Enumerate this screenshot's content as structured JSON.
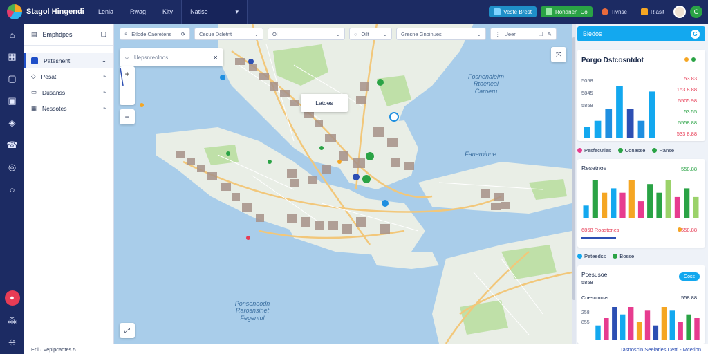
{
  "app": {
    "title": "Stagol Hingendi"
  },
  "topnav": [
    {
      "label": "Lenia"
    },
    {
      "label": "Rwag"
    },
    {
      "label": "Kity"
    },
    {
      "label": "Natise",
      "active": true
    }
  ],
  "topright": {
    "pill_blue": "Veste Brest",
    "pill_green": "Ronanen",
    "pill_green_badge": "Co",
    "item_1": "Tivnse",
    "item_2": "Riasit",
    "round_btn": "G"
  },
  "rail_icons": [
    "home-icon",
    "grid-icon",
    "square-icon",
    "folder-icon",
    "layers-icon",
    "phone-icon",
    "compass-icon",
    "search-icon"
  ],
  "rail_bottom_icons": [
    "alert-icon",
    "apps-icon",
    "settings-icon"
  ],
  "layers": {
    "title": "Emphdpes",
    "items": [
      {
        "label": "Patesnent",
        "selected": true
      },
      {
        "label": "Pesat"
      },
      {
        "label": "Dusanss"
      },
      {
        "label": "Nessotes"
      }
    ]
  },
  "filters": [
    {
      "label": "Etlode Caeretens"
    },
    {
      "label": "Cesue Dcletnt"
    },
    {
      "label": "Ol"
    },
    {
      "label": "Oilt"
    },
    {
      "label": "Gresne Gnoinues"
    },
    {
      "label": "Ueer"
    }
  ],
  "search": {
    "placeholder": "Uepsnreolnos"
  },
  "map": {
    "popup": "Latoes",
    "water_labels": [
      {
        "text": "Fosnenaleirn\nRtoeneal\nCaroeru"
      },
      {
        "text": "Faneroinne"
      },
      {
        "text": "Ponseneodn\nRarosnsinet\nFegentul"
      }
    ],
    "colors": {
      "water": "#a9cdea",
      "land": "#e9eee6",
      "park": "#bfe0a8",
      "road": "#f2c77a",
      "block": "#a79289"
    }
  },
  "right": {
    "header": "Bledos",
    "header_btn": "G",
    "card1": {
      "title": "Porgo Dstcosntdot",
      "values": [
        "53.83",
        "153 8.88",
        "5505.98",
        "53.55",
        "5558.88",
        "533 8.88"
      ],
      "value_colors": [
        "#e73c55",
        "#e73c55",
        "#e73c55",
        "#2aa345",
        "#2aa345",
        "#e73c55"
      ],
      "labels": [
        "5058",
        "5845",
        "5858"
      ]
    },
    "legend1": [
      {
        "label": "Pesfecuties",
        "color": "#e73c8f"
      },
      {
        "label": "Conasse",
        "color": "#2aa345"
      },
      {
        "label": "Ranse",
        "color": "#2aa345"
      }
    ],
    "card2": {
      "title": "Resetnoe",
      "value": "558.88",
      "footer_left": "6858 Roastenes",
      "footer_right": "5558.88"
    },
    "legend2": [
      {
        "label": "Peteedss",
        "color": "#13a8ef"
      },
      {
        "label": "Bosse",
        "color": "#2aa345"
      }
    ],
    "card3": {
      "title": "Pcesusoe",
      "subtitle": "5858",
      "chip": "Coss",
      "row_label": "Coesoinovs",
      "row_value": "558.88",
      "axis": [
        "258",
        "855"
      ]
    }
  },
  "chart_data": [
    {
      "type": "bar",
      "title": "Porgo Dstcosntdot",
      "series": [
        {
          "values": [
            2,
            3,
            5,
            9,
            5,
            3,
            8
          ]
        }
      ],
      "colors": [
        "#13a8ef",
        "#13a8ef",
        "#1f8fe0",
        "#13a8ef",
        "#2d4fb3",
        "#1f8fe0",
        "#13a8ef"
      ]
    },
    {
      "type": "bar",
      "title": "Resetnoe",
      "series": [
        {
          "values": [
            3,
            9,
            6,
            7,
            6,
            9,
            4,
            8,
            6,
            9,
            5,
            7,
            5
          ]
        }
      ],
      "colors": [
        "#13a8ef",
        "#2aa345",
        "#f5a623",
        "#13a8ef",
        "#e73c8f",
        "#f5a623",
        "#e73c8f",
        "#2aa345",
        "#2aa345",
        "#9bd26a",
        "#e73c8f",
        "#2aa345",
        "#9bd26a"
      ]
    },
    {
      "type": "bar",
      "title": "Pcesusoe",
      "series": [
        {
          "values": [
            4,
            6,
            9,
            7,
            9,
            5,
            8,
            4,
            9,
            8,
            5,
            7,
            6
          ]
        }
      ],
      "colors": [
        "#13a8ef",
        "#e73c8f",
        "#2d4fb3",
        "#13a8ef",
        "#e73c8f",
        "#f5a623",
        "#e73c8f",
        "#2d4fb3",
        "#f5a623",
        "#13a8ef",
        "#e73c8f",
        "#2aa345",
        "#e73c8f"
      ]
    }
  ],
  "status": {
    "left": "Eril · Vepipcaotes 5",
    "right": "Tasnoscin Seelaries Detti - Mcetion"
  }
}
